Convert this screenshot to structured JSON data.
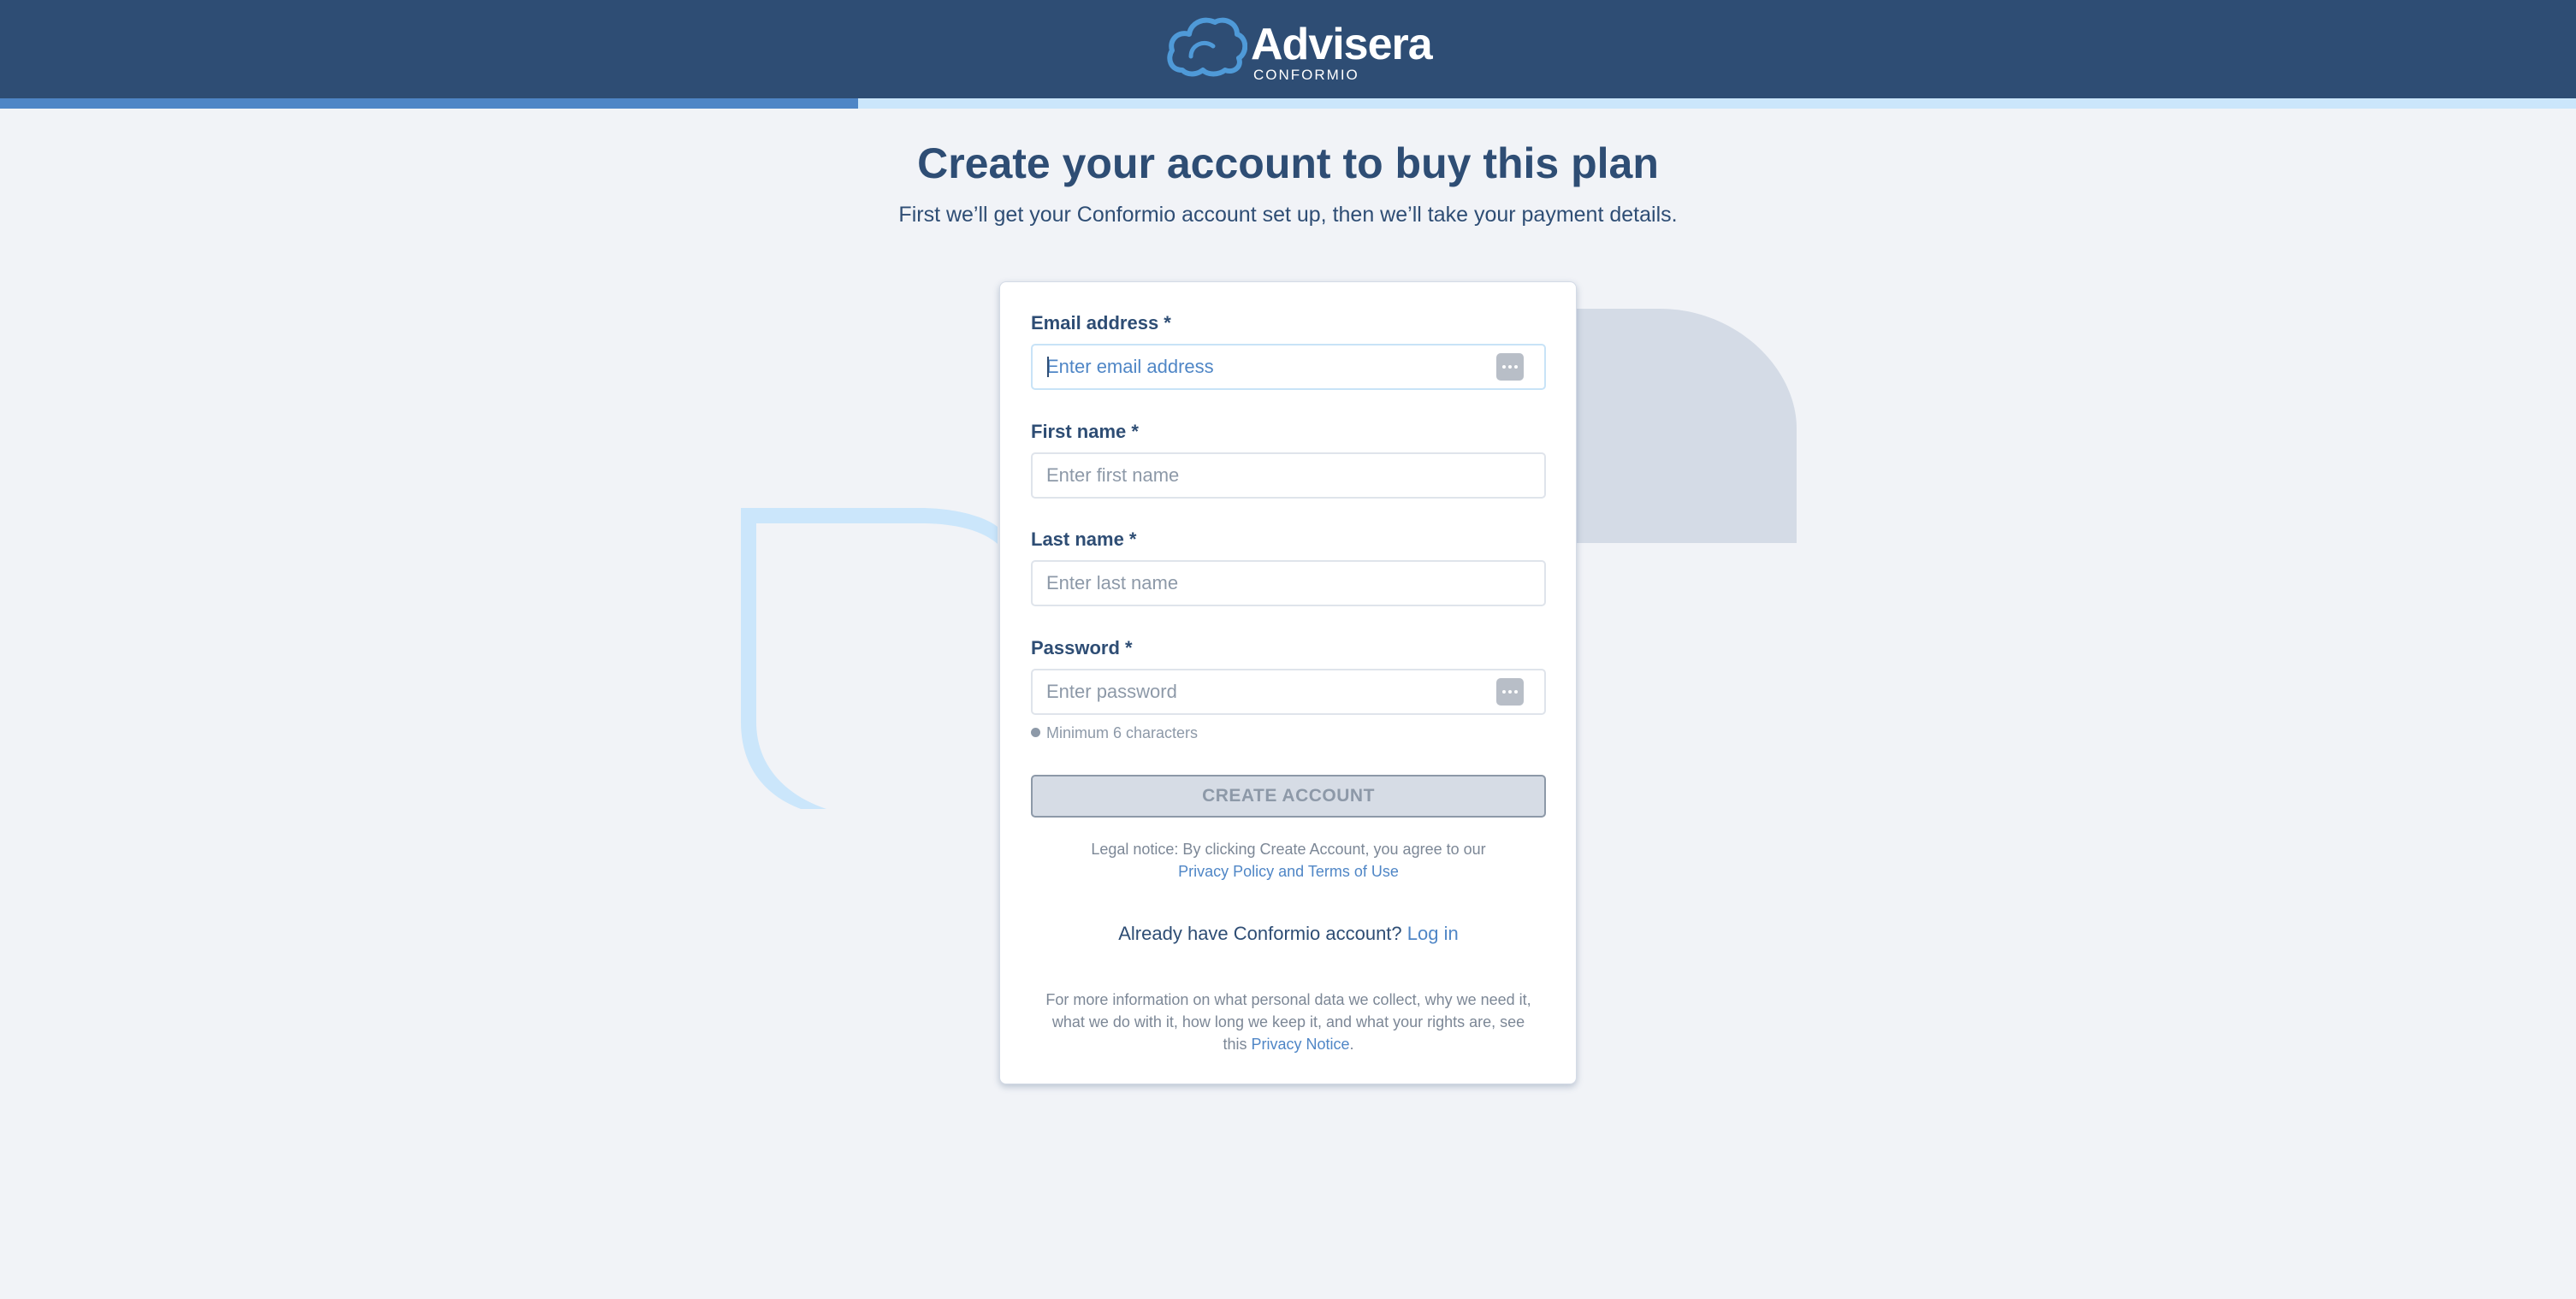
{
  "colors": {
    "header_bg": "#2e4d74",
    "page_bg": "#f1f3f7",
    "accent_blue": "#4f86c6",
    "light_blue": "#cbe6fb",
    "text_dark": "#2e4d74",
    "text_muted": "#8d99a8",
    "disabled_button_bg": "#d6dce5"
  },
  "header": {
    "brand": "Advisera",
    "product": "CONFORMIO",
    "logo_icon": "cloud-icon",
    "progress_fraction": 0.333
  },
  "page": {
    "title": "Create your account to buy this plan",
    "subtitle": "First we’ll get your Conformio account set up, then we’ll take your payment details."
  },
  "form": {
    "email": {
      "label": "Email address *",
      "placeholder": "Enter email address",
      "value": "",
      "focused": true,
      "action_icon": "more-dots-icon"
    },
    "first_name": {
      "label": "First name *",
      "placeholder": "Enter first name",
      "value": ""
    },
    "last_name": {
      "label": "Last name *",
      "placeholder": "Enter last name",
      "value": ""
    },
    "password": {
      "label": "Password *",
      "placeholder": "Enter password",
      "value": "",
      "action_icon": "more-dots-icon",
      "hint": "Minimum 6 characters"
    },
    "submit_label": "CREATE ACCOUNT",
    "submit_disabled": true
  },
  "legal": {
    "text": "Legal notice: By clicking Create Account, you agree to our",
    "link": "Privacy Policy and Terms of Use"
  },
  "login": {
    "text": "Already have Conformio account?",
    "link": "Log in"
  },
  "privacy": {
    "line1": "For more information on what personal data we collect, why we need it,",
    "line2": "what we do with it, how long we keep it, and what your rights are, see",
    "prefix": "this",
    "link": "Privacy Notice",
    "suffix": "."
  }
}
